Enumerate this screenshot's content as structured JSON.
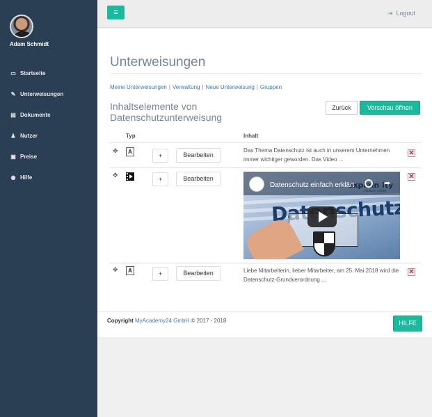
{
  "sidebar": {
    "user_name": "Adam Schmidt",
    "items": [
      {
        "label": "Startseite",
        "icon": "laptop-icon",
        "glyph": "▭"
      },
      {
        "label": "Unterweisungen",
        "icon": "edit-icon",
        "glyph": "✎"
      },
      {
        "label": "Dokumente",
        "icon": "file-icon",
        "glyph": "▤"
      },
      {
        "label": "Nutzer",
        "icon": "user-icon",
        "glyph": "♟"
      },
      {
        "label": "Preise",
        "icon": "money-icon",
        "glyph": "▣"
      },
      {
        "label": "Hilfe",
        "icon": "globe-icon",
        "glyph": "◉"
      }
    ]
  },
  "topbar": {
    "menu_glyph": "≡",
    "logout_label": "Logout",
    "logout_glyph": "⇥"
  },
  "page": {
    "title": "Unterweisungen",
    "links": [
      "Meine Unterweisungen",
      "Verwaltung",
      "Neue Unterweisung",
      "Gruppen"
    ],
    "link_separator": "|",
    "section_title": "Inhaltselemente von Datenschutzunterweisung",
    "back_label": "Zurück",
    "preview_label": "Vorschau öffnen"
  },
  "table": {
    "headers": {
      "typ": "Typ",
      "inhalt": "Inhalt"
    },
    "drag_glyph": "✥",
    "plus_label": "+",
    "edit_label": "Bearbeiten",
    "delete_glyph": "✕",
    "rows": [
      {
        "type": "text",
        "type_glyph": "A",
        "content": "Das Thema Datenschutz ist auch in unserem Unternehmen immer wichtiger geworden. Das Video ..."
      },
      {
        "type": "video",
        "video_title": "Datenschutz einfach erklärt",
        "video_brand": "explain ity",
        "video_subtitle": "...einfach erklärt",
        "video_big_text": "Datenschutz"
      },
      {
        "type": "text",
        "type_glyph": "A",
        "content": "Liebe Mitarbeiterin, lieber Mitarbeiter, am 25. Mai 2018 wird die Datenschutz-Grundverordnung ..."
      }
    ]
  },
  "footer": {
    "copyright_label": "Copyright",
    "company": "MyAcademy24 GmbH",
    "years": "© 2017 - 2018",
    "help_label": "HILFE"
  },
  "colors": {
    "sidebar": "#2a3f54",
    "accent": "#1abb9c",
    "link": "#3c7ab2",
    "delete": "#d9172b"
  }
}
